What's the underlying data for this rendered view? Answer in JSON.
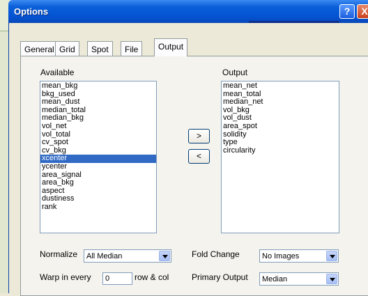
{
  "window": {
    "title": "Options"
  },
  "titlebar_buttons": {
    "help": "?",
    "close": "X"
  },
  "tabs": [
    {
      "label": "General"
    },
    {
      "label": "Grid"
    },
    {
      "label": "Spot"
    },
    {
      "label": "File"
    },
    {
      "label": "Output",
      "active": true
    }
  ],
  "available": {
    "label": "Available",
    "items": [
      "mean_bkg",
      "bkg_used",
      "mean_dust",
      "median_total",
      "median_bkg",
      "vol_net",
      "vol_total",
      "cv_spot",
      "cv_bkg",
      "xcenter",
      "ycenter",
      "area_signal",
      "area_bkg",
      "aspect",
      "dustiness",
      "rank"
    ],
    "selected": "xcenter"
  },
  "output": {
    "label": "Output",
    "items": [
      "mean_net",
      "mean_total",
      "median_net",
      "vol_bkg",
      "vol_dust",
      "area_spot",
      "solidity",
      "type",
      "circularity"
    ]
  },
  "move_buttons": {
    "add": ">",
    "remove": "<"
  },
  "normalize": {
    "label": "Normalize",
    "value": "All Median"
  },
  "fold_change": {
    "label": "Fold Change",
    "value": "No Images"
  },
  "warp": {
    "label_pre": "Warp in every",
    "value": "0",
    "label_post": "row & col"
  },
  "primary_output": {
    "label": "Primary Output",
    "value": "Median"
  },
  "colors": {
    "titlebar": "#0454d4",
    "selection": "#316ac5",
    "dialog_bg": "#ece9d8"
  }
}
